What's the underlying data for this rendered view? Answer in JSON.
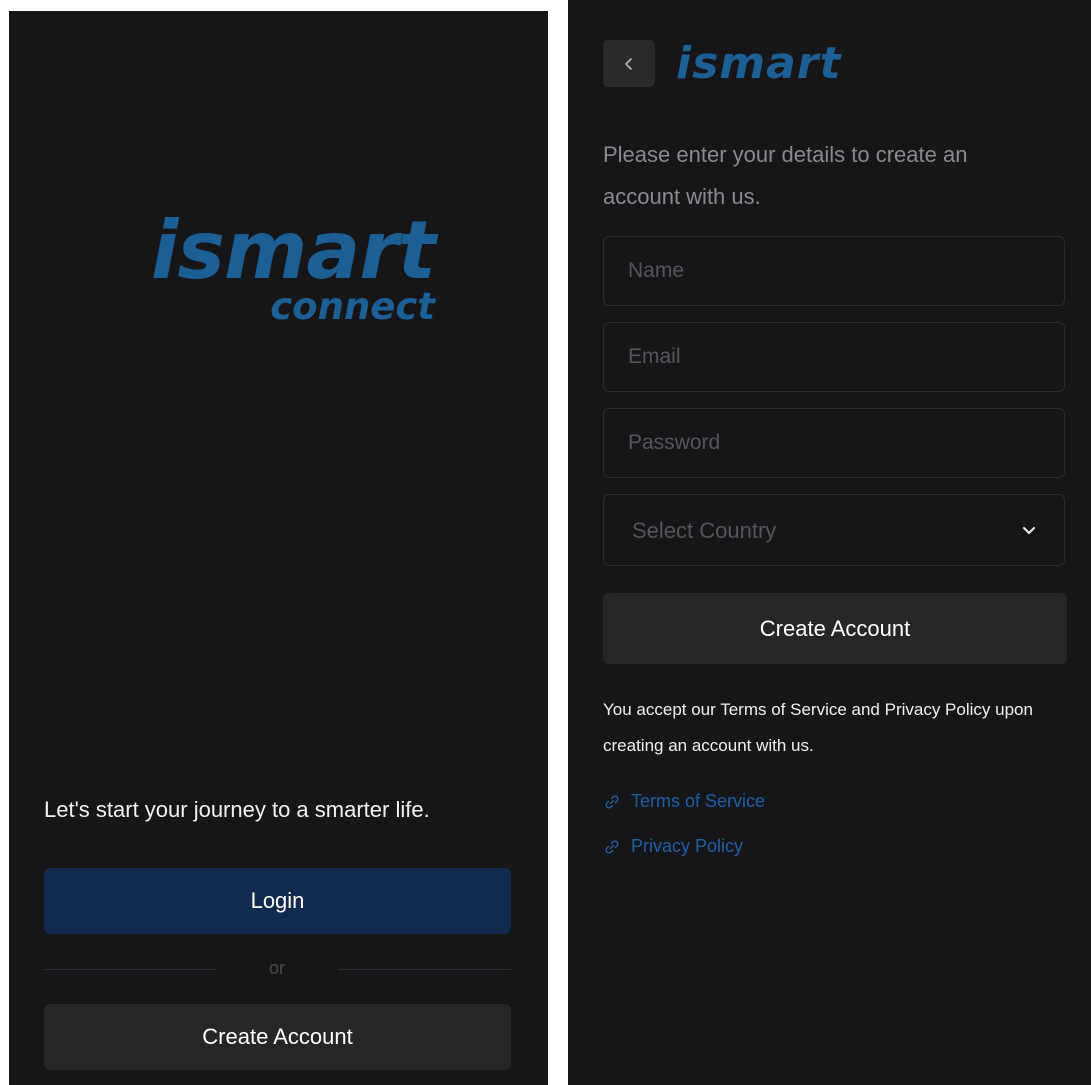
{
  "welcome": {
    "logo_main": "ismart",
    "logo_sub": "connect",
    "tagline": "Let's start your journey to a smarter life.",
    "login_label": "Login",
    "or_label": "or",
    "create_account_label": "Create Account"
  },
  "signup": {
    "back_icon": "chevron-left-icon",
    "logo": "ismart",
    "intro": "Please enter your details to create an account with us.",
    "fields": {
      "name_placeholder": "Name",
      "email_placeholder": "Email",
      "password_placeholder": "Password"
    },
    "country_select": {
      "selected": "Select Country",
      "icon": "chevron-down-icon"
    },
    "create_account_label": "Create Account",
    "terms_text": "You accept our Terms of Service and Privacy Policy upon creating an account with us.",
    "links": {
      "terms": "Terms of Service",
      "privacy": "Privacy Policy",
      "icon": "link-icon"
    }
  },
  "colors": {
    "background": "#161618",
    "brand_blue": "#1c5f95",
    "login_button": "#122a4d",
    "secondary_button": "#262628",
    "link_blue": "#1f5fa8"
  }
}
